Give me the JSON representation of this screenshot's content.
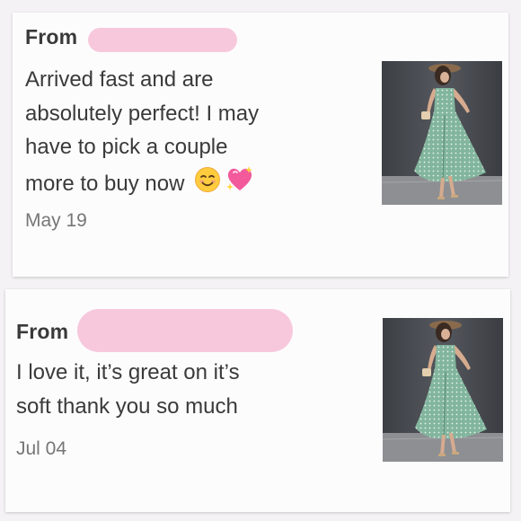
{
  "reviews": [
    {
      "from_label": "From",
      "message_lines": [
        "Arrived fast and are",
        "absolutely perfect! I may",
        "have to pick a couple",
        "more to buy now"
      ],
      "emojis": [
        "smiling-face-icon",
        "sparkling-heart-icon"
      ],
      "date": "May 19",
      "thumbnail": "green-polka-dot-dress-photo"
    },
    {
      "from_label": "From",
      "message_lines": [
        "I love it, it’s great on it’s",
        "soft thank you so much"
      ],
      "date": "Jul 04",
      "thumbnail": "green-polka-dot-dress-photo"
    }
  ],
  "colors": {
    "redaction": "#f7c8dc",
    "text": "#3a3a3a",
    "date": "#767676",
    "dress": "#7fb29a"
  }
}
